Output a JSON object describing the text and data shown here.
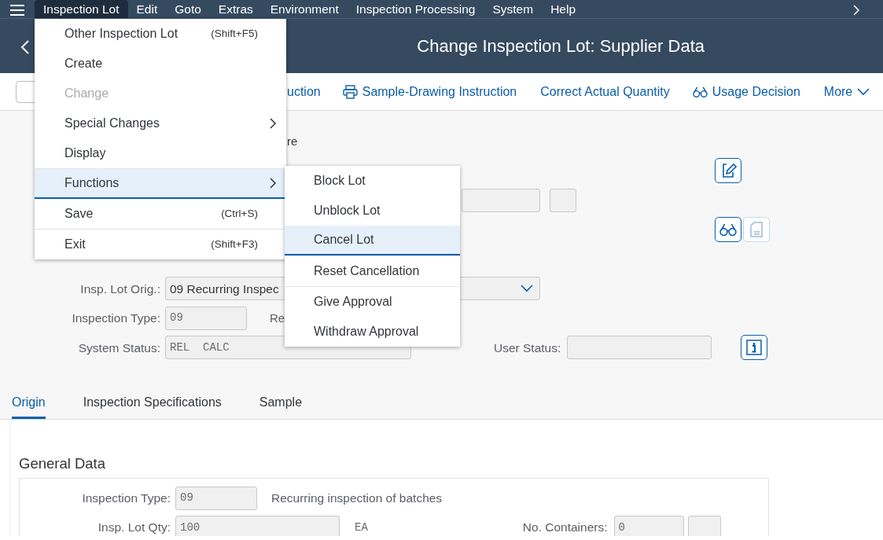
{
  "menubar": {
    "items": [
      {
        "label": "Inspection Lot",
        "selected": true
      },
      {
        "label": "Edit",
        "selected": false
      },
      {
        "label": "Goto",
        "selected": false
      },
      {
        "label": "Extras",
        "selected": false
      },
      {
        "label": "Environment",
        "selected": false
      },
      {
        "label": "Inspection Processing",
        "selected": false
      },
      {
        "label": "System",
        "selected": false
      },
      {
        "label": "Help",
        "selected": false
      }
    ]
  },
  "title": "Change Inspection Lot: Supplier Data",
  "toolbar": {
    "items": [
      {
        "kind": "blank"
      },
      {
        "kind": "text",
        "label": "uction"
      },
      {
        "kind": "print",
        "label": "Sample-Drawing Instruction"
      },
      {
        "kind": "text",
        "label": "Correct Actual Quantity"
      },
      {
        "kind": "decision",
        "label": "Usage Decision"
      },
      {
        "kind": "more",
        "label": "More"
      }
    ]
  },
  "menu": {
    "items": [
      {
        "label": "Other Inspection Lot",
        "shortcut": "(Shift+F5)",
        "submenu": false,
        "disabled": false,
        "selected": false
      },
      {
        "label": "Create",
        "submenu": false,
        "disabled": false,
        "selected": false
      },
      {
        "label": "Change",
        "submenu": false,
        "disabled": true,
        "selected": false
      },
      {
        "label": "Special Changes",
        "submenu": true,
        "disabled": false,
        "selected": false
      },
      {
        "label": "Display",
        "submenu": false,
        "disabled": false,
        "selected": false
      },
      {
        "label": "Functions",
        "submenu": true,
        "disabled": false,
        "selected": true
      },
      {
        "label": "Save",
        "shortcut": "(Ctrl+S)",
        "submenu": false,
        "disabled": false,
        "selected": false
      },
      {
        "label": "Exit",
        "shortcut": "(Shift+F3)",
        "submenu": false,
        "disabled": false,
        "selected": false
      }
    ]
  },
  "submenu": {
    "items": [
      {
        "label": "Block Lot",
        "selected": false
      },
      {
        "label": "Unblock Lot",
        "selected": false
      },
      {
        "label": "Cancel Lot",
        "selected": true
      },
      {
        "label": "Reset Cancellation",
        "selected": false
      },
      {
        "label": "Give Approval",
        "selected": false
      },
      {
        "label": "Withdraw Approval",
        "selected": false
      }
    ]
  },
  "header_form": {
    "partial_label": "re",
    "buttons": [
      {
        "kind": "edit",
        "disabled": false
      },
      {
        "kind": "display",
        "disabled": false
      },
      {
        "kind": "document",
        "disabled": true
      },
      {
        "kind": "info",
        "disabled": false
      }
    ],
    "origin": {
      "label": "Insp. Lot Orig.:",
      "value": "09 Recurring Inspec"
    },
    "inspection_type": {
      "label": "Inspection Type:",
      "value": "09",
      "description": "Re"
    },
    "system_status": {
      "label": "System Status:",
      "value": "REL  CALC"
    },
    "user_status": {
      "label": "User Status:"
    }
  },
  "tabs": [
    {
      "label": "Origin",
      "selected": true
    },
    {
      "label": "Inspection Specifications",
      "selected": false
    },
    {
      "label": "Sample",
      "selected": false
    }
  ],
  "general_data": {
    "title": "General Data",
    "inspection_type": {
      "label": "Inspection Type:",
      "value": "09",
      "description": "Recurring inspection of batches"
    },
    "lot_qty": {
      "label": "Insp. Lot Qty:",
      "value": "100",
      "unit": "EA"
    },
    "containers": {
      "label": "No. Containers:",
      "value": "0"
    }
  }
}
